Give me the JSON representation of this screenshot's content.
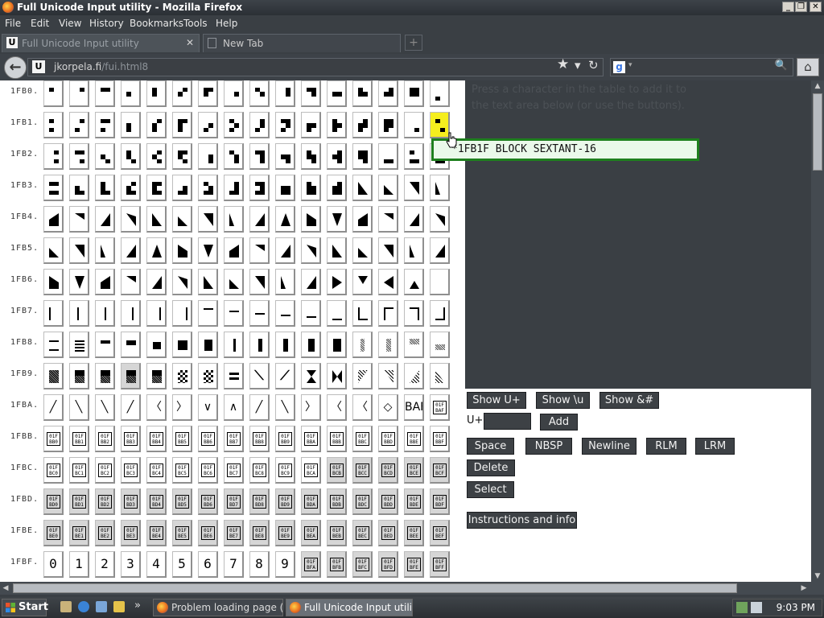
{
  "window": {
    "title": "Full Unicode Input utility - Mozilla Firefox",
    "controls": {
      "minimize": "_",
      "maximize": "❐",
      "close": "✕"
    }
  },
  "menu": [
    "File",
    "Edit",
    "View",
    "History",
    "Bookmarks",
    "Tools",
    "Help"
  ],
  "tabs": [
    {
      "label": "Full Unicode Input utility",
      "favicon": "U",
      "active": true,
      "close": "✕"
    },
    {
      "label": "New Tab",
      "active": false
    }
  ],
  "newtab_icon": "plus-icon",
  "nav": {
    "back_icon": "back-arrow-icon",
    "site_icon_letter": "U",
    "url_host": "jkorpela.fi",
    "url_path": "/fui.html8",
    "star": "★",
    "dropdown": "▾",
    "reload": "↻",
    "search_engine_letter": "g",
    "search_icon": "🔍",
    "home_icon": "⌂"
  },
  "grid": {
    "row_labels": [
      "1FB0.",
      "1FB1.",
      "1FB2.",
      "1FB3.",
      "1FB4.",
      "1FB5.",
      "1FB6.",
      "1FB7.",
      "1FB8.",
      "1FB9.",
      "1FBA.",
      "1FBB.",
      "1FBC.",
      "1FBD.",
      "1FBE.",
      "1FBF."
    ],
    "highlighted_char": "1FB1F",
    "rowBA_glyphs": [
      "╱",
      "╲",
      "╲",
      "╱",
      "〈",
      "〉",
      "∨",
      "∧",
      "╱",
      "╲",
      "〉",
      "〈",
      "〈",
      "◇",
      "BAF"
    ],
    "rowBF_digits": [
      "0",
      "1",
      "2",
      "3",
      "4",
      "5",
      "6",
      "7",
      "8",
      "9"
    ],
    "rowBF_codes": [
      "BFA",
      "BFB",
      "BFC",
      "BFD",
      "BFE",
      "BFF"
    ],
    "prefix": "01F"
  },
  "tooltip": {
    "text": "*1FB1F BLOCK SEXTANT-16"
  },
  "ghost_text": {
    "line1": "Press a character in the table to add it to",
    "line2": "the text area below (or use the buttons)."
  },
  "buttons": {
    "show_uplus": "Show U+",
    "show_u": "Show \\u",
    "show_amp": "Show &#",
    "uplus_label": "U+",
    "uplus_value": "",
    "add": "Add",
    "space": "Space",
    "nbsp": "NBSP",
    "newline": "Newline",
    "rlm": "RLM",
    "lrm": "LRM",
    "delete": "Delete",
    "select": "Select",
    "instructions": "Instructions and info"
  },
  "scrollbars": {
    "up": "▲",
    "down": "▼",
    "left": "◀",
    "right": "▶"
  },
  "taskbar": {
    "start": "Start",
    "more": "»",
    "tasks": [
      {
        "label": "Problem loading page (K-...",
        "active": false
      },
      {
        "label": "Full Unicode Input utili...",
        "active": true
      }
    ],
    "clock": "9:03 PM"
  },
  "colors": {
    "highlight": "#f5ee1e",
    "tooltip_border": "#1e7f1e",
    "tooltip_bg": "#eaf9ea",
    "chrome_dark": "#3a3f44"
  }
}
